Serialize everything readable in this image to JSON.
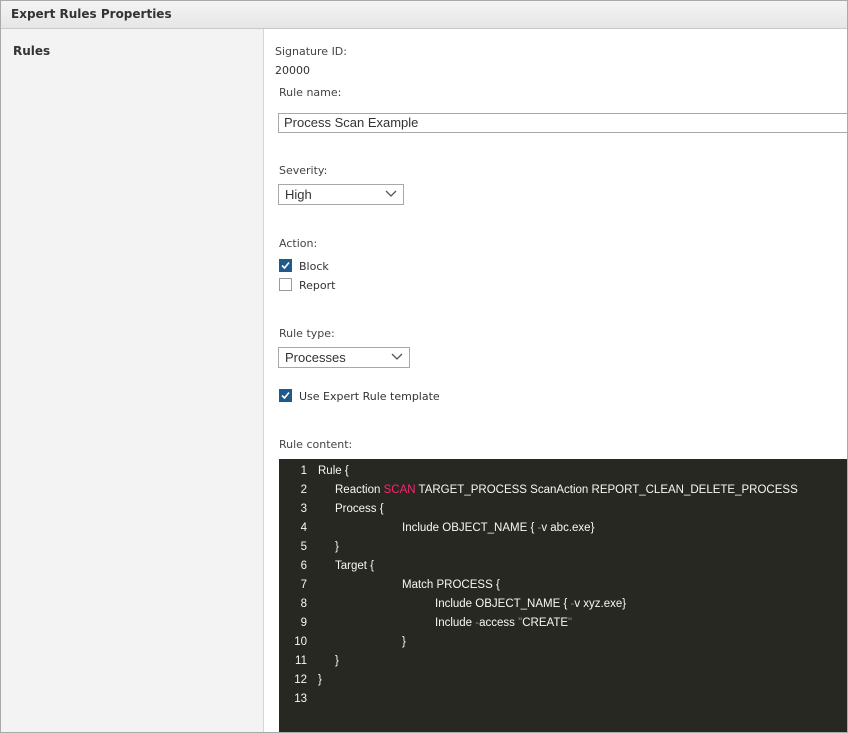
{
  "window": {
    "title": "Expert Rules Properties"
  },
  "sidebar": {
    "section": "Rules"
  },
  "form": {
    "signature_label": "Signature ID:",
    "signature_value": "20000",
    "rule_name_label": "Rule name:",
    "rule_name_value": "Process Scan Example",
    "severity_label": "Severity:",
    "severity_value": "High",
    "action_label": "Action:",
    "action_options": [
      {
        "label": "Block",
        "checked": true
      },
      {
        "label": "Report",
        "checked": false
      }
    ],
    "rule_type_label": "Rule type:",
    "rule_type_value": "Processes",
    "template_label": "Use Expert Rule template",
    "template_checked": true,
    "content_label": "Rule content:"
  },
  "code": {
    "line_numbers": [
      "1",
      "2",
      "3",
      "4",
      "5",
      "6",
      "7",
      "8",
      "9",
      "10",
      "11",
      "12",
      "13"
    ],
    "lines": {
      "l1": "Rule {",
      "l2_a": "Reaction ",
      "l2_kw": "SCAN",
      "l2_b": " TARGET_PROCESS ScanAction REPORT_CLEAN_DELETE_PROCESS",
      "l3": "Process {",
      "l4_a": "Include OBJECT_NAME { ",
      "l4_dim": "-",
      "l4_b": "v abc.exe}",
      "l5": "}",
      "l6": "Target {",
      "l7": "Match PROCESS {",
      "l8_a": "Include OBJECT_NAME { ",
      "l8_dim": "-",
      "l8_b": "v xyz.exe}",
      "l9_a": "Include ",
      "l9_dim1": "-",
      "l9_b": "access ",
      "l9_dim2": "\"",
      "l9_c": "CREATE",
      "l9_dim3": "\"",
      "l10": "}",
      "l11": "}",
      "l12": "}"
    }
  },
  "colors": {
    "code_bg": "#272822",
    "keyword": "#f92672",
    "checkbox_checked": "#1e5a8c"
  }
}
